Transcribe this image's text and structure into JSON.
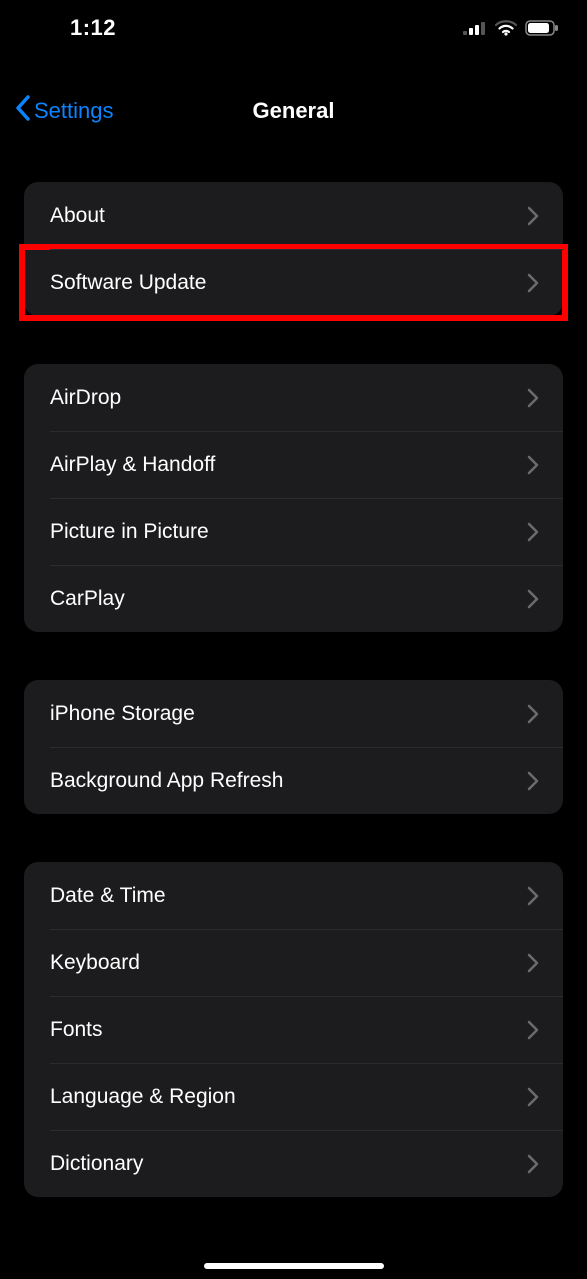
{
  "status_bar": {
    "time": "1:12"
  },
  "nav": {
    "back_label": "Settings",
    "title": "General"
  },
  "groups": [
    {
      "rows": [
        {
          "key": "about",
          "label": "About",
          "highlighted": false
        },
        {
          "key": "software_update",
          "label": "Software Update",
          "highlighted": true
        }
      ]
    },
    {
      "rows": [
        {
          "key": "airdrop",
          "label": "AirDrop",
          "highlighted": false
        },
        {
          "key": "airplay",
          "label": "AirPlay & Handoff",
          "highlighted": false
        },
        {
          "key": "pip",
          "label": "Picture in Picture",
          "highlighted": false
        },
        {
          "key": "carplay",
          "label": "CarPlay",
          "highlighted": false
        }
      ]
    },
    {
      "rows": [
        {
          "key": "storage",
          "label": "iPhone Storage",
          "highlighted": false
        },
        {
          "key": "bg_refresh",
          "label": "Background App Refresh",
          "highlighted": false
        }
      ]
    },
    {
      "rows": [
        {
          "key": "date_time",
          "label": "Date & Time",
          "highlighted": false
        },
        {
          "key": "keyboard",
          "label": "Keyboard",
          "highlighted": false
        },
        {
          "key": "fonts",
          "label": "Fonts",
          "highlighted": false
        },
        {
          "key": "lang_region",
          "label": "Language & Region",
          "highlighted": false
        },
        {
          "key": "dictionary",
          "label": "Dictionary",
          "highlighted": false
        }
      ]
    }
  ]
}
